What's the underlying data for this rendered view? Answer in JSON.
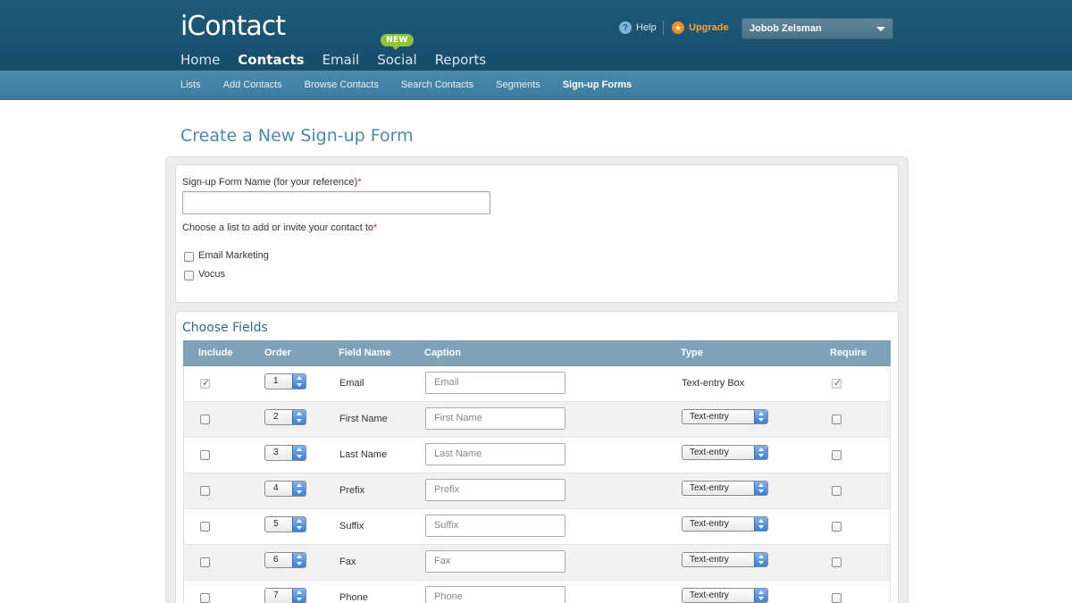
{
  "header": {
    "logo": "iContact",
    "nav": [
      {
        "label": "Home"
      },
      {
        "label": "Contacts"
      },
      {
        "label": "Email"
      },
      {
        "label": "Social",
        "badge": "NEW"
      },
      {
        "label": "Reports"
      }
    ],
    "help_label": "Help",
    "upgrade_label": "Upgrade",
    "user_name": "Jobob Zelsman"
  },
  "subnav": [
    {
      "label": "Lists"
    },
    {
      "label": "Add Contacts"
    },
    {
      "label": "Browse Contacts"
    },
    {
      "label": "Search Contacts"
    },
    {
      "label": "Segments"
    },
    {
      "label": "Sign-up Forms"
    }
  ],
  "page": {
    "title": "Create a New Sign-up Form",
    "form_name_label": "Sign-up Form Name (for your reference)",
    "form_name_value": "",
    "list_label": "Choose a list to add or invite your contact to",
    "required_mark": "*",
    "lists": [
      {
        "label": "Email Marketing",
        "checked": false
      },
      {
        "label": "Vocus",
        "checked": false
      }
    ]
  },
  "fields_section": {
    "title": "Choose Fields",
    "columns": [
      "Include",
      "Order",
      "Field Name",
      "Caption",
      "Type",
      "Require"
    ],
    "rows": [
      {
        "order": "1",
        "field": "Email",
        "caption": "Email",
        "type": "Text-entry Box",
        "type_select": false,
        "include": true,
        "require": true
      },
      {
        "order": "2",
        "field": "First Name",
        "caption": "First Name",
        "type": "Text-entry",
        "type_select": true,
        "include": false,
        "require": false
      },
      {
        "order": "3",
        "field": "Last Name",
        "caption": "Last Name",
        "type": "Text-entry",
        "type_select": true,
        "include": false,
        "require": false
      },
      {
        "order": "4",
        "field": "Prefix",
        "caption": "Prefix",
        "type": "Text-entry",
        "type_select": true,
        "include": false,
        "require": false
      },
      {
        "order": "5",
        "field": "Suffix",
        "caption": "Suffix",
        "type": "Text-entry",
        "type_select": true,
        "include": false,
        "require": false
      },
      {
        "order": "6",
        "field": "Fax",
        "caption": "Fax",
        "type": "Text-entry",
        "type_select": true,
        "include": false,
        "require": false
      },
      {
        "order": "7",
        "field": "Phone",
        "caption": "Phone",
        "type": "Text-entry",
        "type_select": true,
        "include": false,
        "require": false
      }
    ]
  },
  "colors": {
    "header_bg": "#1a5272",
    "subnav_bg": "#4283a5",
    "table_header_bg": "#7ea3b8",
    "title_color": "#4f88a6",
    "badge_green": "#8fc23e",
    "upgrade_orange": "#f48f1d"
  }
}
